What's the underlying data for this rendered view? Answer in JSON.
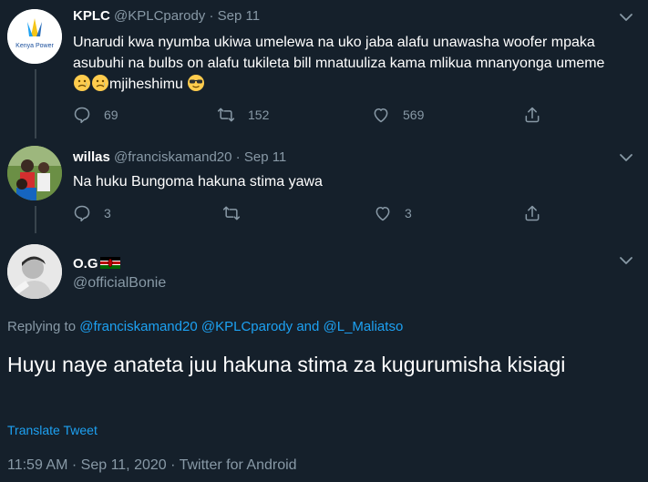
{
  "tweet1": {
    "name": "KPLC",
    "handle": "@KPLCparody",
    "sep": "·",
    "date": "Sep 11",
    "avatar_text": "Kenya Power",
    "text_a": "Unarudi kwa nyumba ukiwa umelewa na uko jaba alafu unawasha woofer mpaka asubuhi na bulbs on alafu tukileta bill mnatuuliza kama mlikua mnanyonga umeme",
    "text_b": "mjiheshimu",
    "replies": "69",
    "retweets": "152",
    "likes": "569"
  },
  "tweet2": {
    "name": "willas",
    "handle": "@franciskamand20",
    "sep": "·",
    "date": "Sep 11",
    "text": "Na huku Bungoma hakuna stima yawa",
    "replies": "3",
    "likes": "3"
  },
  "tweet3": {
    "name": "O.G",
    "handle": "@officialBonie",
    "replying_prefix": "Replying to",
    "mention1": "@franciskamand20",
    "mention2": "@KPLCparody",
    "and_text": "and",
    "mention3": "@L_Maliatso",
    "text": "Huyu naye anateta juu hakuna stima za kugurumisha kisiagi",
    "translate": "Translate Tweet",
    "time": "11:59 AM",
    "sep": "·",
    "date": "Sep 11, 2020",
    "source": "Twitter for Android"
  },
  "colors": {
    "background": "#15202b",
    "text": "#ffffff",
    "secondary": "#8899a6",
    "link": "#1da1f2",
    "border": "#38444d"
  },
  "icons": [
    "reply-icon",
    "retweet-icon",
    "like-icon",
    "share-icon",
    "chevron-down-icon"
  ]
}
